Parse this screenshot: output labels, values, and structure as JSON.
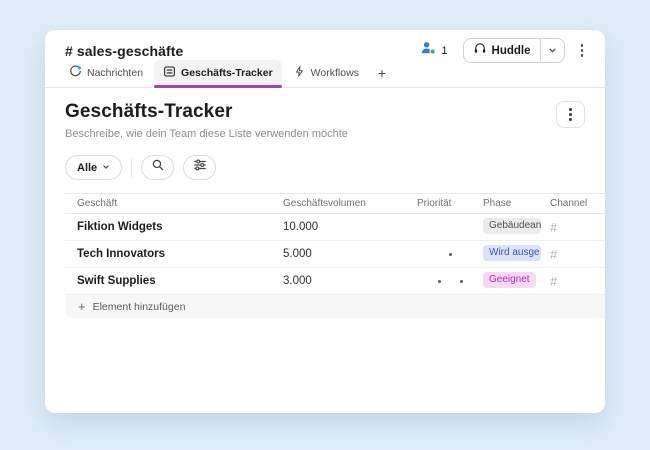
{
  "header": {
    "channel_name": "# sales-geschäfte",
    "member_count": "1",
    "huddle_label": "Huddle"
  },
  "tabs": {
    "nachrichten": "Nachrichten",
    "tracker": "Geschäfts-Tracker",
    "workflows": "Workflows",
    "add": "+"
  },
  "page": {
    "title": "Geschäfts-Tracker",
    "subtitle": "Beschreibe, wie dein Team diese Liste verwenden möchte"
  },
  "toolbar": {
    "filter_label": "Alle"
  },
  "table": {
    "columns": [
      "Geschäft",
      "Geschäftsvolumen",
      "Priorität",
      "Phase",
      "Channel"
    ],
    "rows": [
      {
        "name": "Fiktion Widgets",
        "volume": "10.000",
        "priority_dots": 0,
        "phase": "Gebäudean…",
        "phase_bg": "#ebebeb",
        "phase_text": "#525252",
        "channel": "#"
      },
      {
        "name": "Tech Innovators",
        "volume": "5.000",
        "priority_dots": 1,
        "phase": "Wird ausge…",
        "phase_bg": "#dce3fa",
        "phase_text": "#3c51cc",
        "channel": "#"
      },
      {
        "name": "Swift Supplies",
        "volume": "3.000",
        "priority_dots": 2,
        "phase": "Geeignet",
        "phase_bg": "#f8d9f5",
        "phase_text": "#b12fb1",
        "channel": "#"
      }
    ],
    "add_row_label": "Element hinzufügen",
    "add_row_plus": "+"
  },
  "colors": {
    "active_tab_underline": "#9c49a8",
    "presence_green": "#2eb67d",
    "member_icon_blue": "#4178be",
    "unread_dot_blue": "#42a5e3",
    "page_background": "#dfecf8"
  }
}
